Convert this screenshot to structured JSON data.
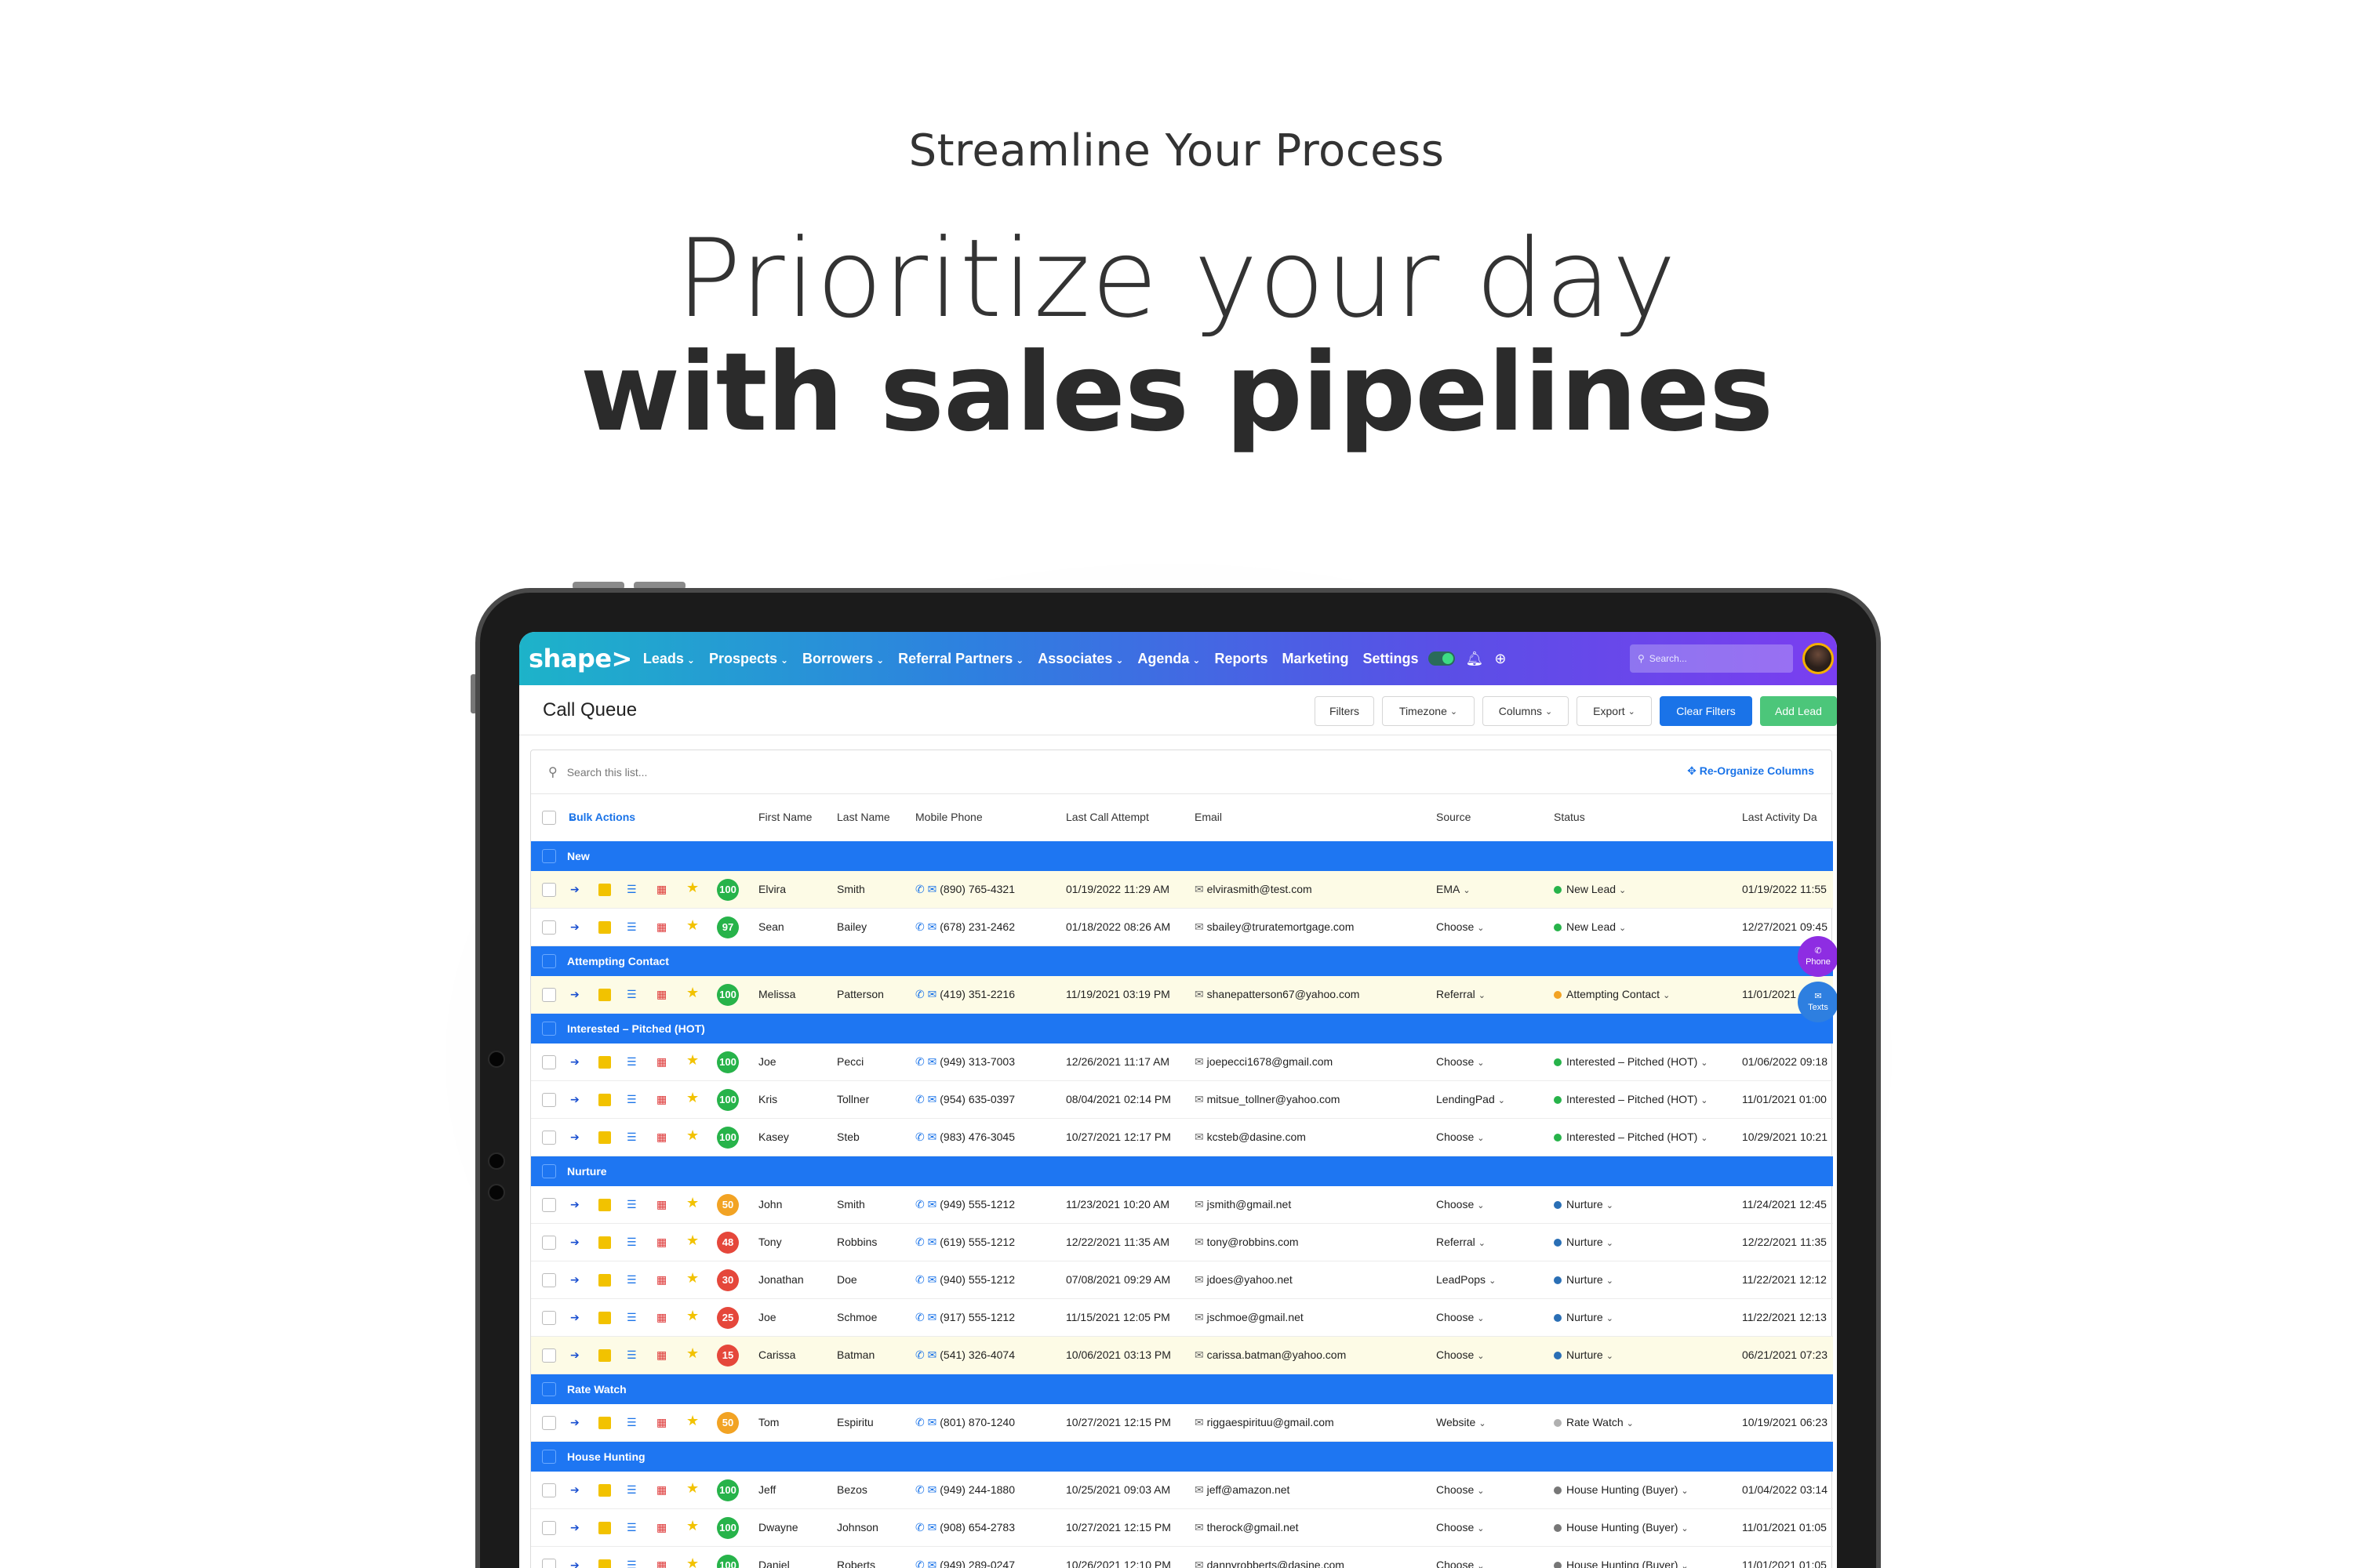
{
  "hero": {
    "eyebrow": "Streamline Your Process",
    "line1": "Prioritize your day",
    "line2": "with sales pipelines"
  },
  "nav": {
    "logo": "shape>",
    "items": [
      "Leads",
      "Prospects",
      "Borrowers",
      "Referral Partners",
      "Associates",
      "Agenda",
      "Reports",
      "Marketing",
      "Settings"
    ],
    "search_placeholder": "Search..."
  },
  "toolbar": {
    "title": "Call Queue",
    "filters": "Filters",
    "timezone": "Timezone",
    "columns": "Columns",
    "export": "Export",
    "clear_filters": "Clear Filters",
    "add_lead": "Add Lead"
  },
  "list": {
    "search_placeholder": "Search this list...",
    "reorganize": "Re-Organize Columns",
    "bulk_actions": "Bulk Actions",
    "headers": {
      "first": "First Name",
      "last": "Last Name",
      "mobile": "Mobile Phone",
      "last_call": "Last Call Attempt",
      "email": "Email",
      "source": "Source",
      "status": "Status",
      "last_activity": "Last Activity Da"
    }
  },
  "colors": {
    "score_green": "#27b34a",
    "score_orange": "#f2a324",
    "score_red": "#e5473b",
    "group_blue": "#1e76f2"
  },
  "groups": [
    {
      "label": "New",
      "rows": [
        {
          "score": "100",
          "score_color": "green",
          "first": "Elvira",
          "last": "Smith",
          "phone": "(890) 765-4321",
          "call": "01/19/2022 11:29 AM",
          "email": "elvirasmith@test.com",
          "source": "EMA",
          "status": "New Lead",
          "status_color": "#27b34a",
          "activity": "01/19/2022 11:55",
          "highlight": true
        },
        {
          "score": "97",
          "score_color": "green",
          "first": "Sean",
          "last": "Bailey",
          "phone": "(678) 231-2462",
          "call": "01/18/2022 08:26 AM",
          "email": "sbailey@truratemortgage.com",
          "source": "Choose",
          "status": "New Lead",
          "status_color": "#27b34a",
          "activity": "12/27/2021 09:45",
          "highlight": false
        }
      ]
    },
    {
      "label": "Attempting Contact",
      "rows": [
        {
          "score": "100",
          "score_color": "green",
          "first": "Melissa",
          "last": "Patterson",
          "phone": "(419) 351-2216",
          "call": "11/19/2021 03:19 PM",
          "email": "shanepatterson67@yahoo.com",
          "source": "Referral",
          "status": "Attempting Contact",
          "status_color": "#f2a324",
          "activity": "11/01/2021",
          "highlight": true
        }
      ]
    },
    {
      "label": "Interested – Pitched (HOT)",
      "rows": [
        {
          "score": "100",
          "score_color": "green",
          "first": "Joe",
          "last": "Pecci",
          "phone": "(949) 313-7003",
          "call": "12/26/2021 11:17 AM",
          "email": "joepecci1678@gmail.com",
          "source": "Choose",
          "status": "Interested – Pitched (HOT)",
          "status_color": "#27b34a",
          "activity": "01/06/2022 09:18",
          "highlight": false
        },
        {
          "score": "100",
          "score_color": "green",
          "first": "Kris",
          "last": "Tollner",
          "phone": "(954) 635-0397",
          "call": "08/04/2021 02:14 PM",
          "email": "mitsue_tollner@yahoo.com",
          "source": "LendingPad",
          "status": "Interested – Pitched (HOT)",
          "status_color": "#27b34a",
          "activity": "11/01/2021 01:00",
          "highlight": false
        },
        {
          "score": "100",
          "score_color": "green",
          "first": "Kasey",
          "last": "Steb",
          "phone": "(983) 476-3045",
          "call": "10/27/2021 12:17 PM",
          "email": "kcsteb@dasine.com",
          "source": "Choose",
          "status": "Interested – Pitched (HOT)",
          "status_color": "#27b34a",
          "activity": "10/29/2021 10:21",
          "highlight": false
        }
      ]
    },
    {
      "label": "Nurture",
      "rows": [
        {
          "score": "50",
          "score_color": "orange",
          "first": "John",
          "last": "Smith",
          "phone": "(949) 555-1212",
          "call": "11/23/2021 10:20 AM",
          "email": "jsmith@gmail.net",
          "source": "Choose",
          "status": "Nurture",
          "status_color": "#2a6fb5",
          "activity": "11/24/2021 12:45",
          "highlight": false
        },
        {
          "score": "48",
          "score_color": "red",
          "first": "Tony",
          "last": "Robbins",
          "phone": "(619) 555-1212",
          "call": "12/22/2021 11:35 AM",
          "email": "tony@robbins.com",
          "source": "Referral",
          "status": "Nurture",
          "status_color": "#2a6fb5",
          "activity": "12/22/2021 11:35",
          "highlight": false
        },
        {
          "score": "30",
          "score_color": "red",
          "first": "Jonathan",
          "last": "Doe",
          "phone": "(940) 555-1212",
          "call": "07/08/2021 09:29 AM",
          "email": "jdoes@yahoo.net",
          "source": "LeadPops",
          "status": "Nurture",
          "status_color": "#2a6fb5",
          "activity": "11/22/2021 12:12",
          "highlight": false
        },
        {
          "score": "25",
          "score_color": "red",
          "first": "Joe",
          "last": "Schmoe",
          "phone": "(917) 555-1212",
          "call": "11/15/2021 12:05 PM",
          "email": "jschmoe@gmail.net",
          "source": "Choose",
          "status": "Nurture",
          "status_color": "#2a6fb5",
          "activity": "11/22/2021 12:13",
          "highlight": false
        },
        {
          "score": "15",
          "score_color": "red",
          "first": "Carissa",
          "last": "Batman",
          "phone": "(541) 326-4074",
          "call": "10/06/2021 03:13 PM",
          "email": "carissa.batman@yahoo.com",
          "source": "Choose",
          "status": "Nurture",
          "status_color": "#2a6fb5",
          "activity": "06/21/2021 07:23",
          "highlight": true
        }
      ]
    },
    {
      "label": "Rate Watch",
      "rows": [
        {
          "score": "50",
          "score_color": "orange",
          "first": "Tom",
          "last": "Espiritu",
          "phone": "(801) 870-1240",
          "call": "10/27/2021 12:15 PM",
          "email": "riggaespirituu@gmail.com",
          "source": "Website",
          "status": "Rate Watch",
          "status_color": "#b0b0b0",
          "activity": "10/19/2021 06:23",
          "highlight": false
        }
      ]
    },
    {
      "label": "House Hunting",
      "rows": [
        {
          "score": "100",
          "score_color": "green",
          "first": "Jeff",
          "last": "Bezos",
          "phone": "(949) 244-1880",
          "call": "10/25/2021 09:03 AM",
          "email": "jeff@amazon.net",
          "source": "Choose",
          "status": "House Hunting (Buyer)",
          "status_color": "#777777",
          "activity": "01/04/2022 03:14",
          "highlight": false
        },
        {
          "score": "100",
          "score_color": "green",
          "first": "Dwayne",
          "last": "Johnson",
          "phone": "(908) 654-2783",
          "call": "10/27/2021 12:15 PM",
          "email": "therock@gmail.net",
          "source": "Choose",
          "status": "House Hunting (Buyer)",
          "status_color": "#777777",
          "activity": "11/01/2021 01:05",
          "highlight": false
        },
        {
          "score": "100",
          "score_color": "green",
          "first": "Daniel",
          "last": "Roberts",
          "phone": "(949) 289-0247",
          "call": "10/26/2021 12:10 PM",
          "email": "dannyrobberts@dasine.com",
          "source": "Choose",
          "status": "House Hunting (Buyer)",
          "status_color": "#777777",
          "activity": "11/01/2021 01:05",
          "highlight": false
        }
      ]
    }
  ],
  "floating": {
    "phone": "Phone",
    "texts": "Texts"
  }
}
